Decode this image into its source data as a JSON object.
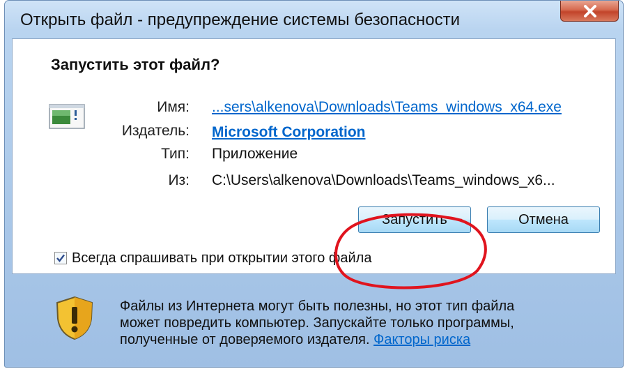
{
  "window": {
    "title": "Открыть файл - предупреждение системы безопасности"
  },
  "dialog": {
    "question": "Запустить этот файл?",
    "fields": {
      "name_label": "Имя:",
      "name_value": "...sers\\alkenova\\Downloads\\Teams_windows_x64.exe",
      "publisher_label": "Издатель:",
      "publisher_value": "Microsoft Corporation",
      "type_label": "Тип:",
      "type_value": "Приложение",
      "from_label": "Из:",
      "from_value": "C:\\Users\\alkenova\\Downloads\\Teams_windows_x6..."
    },
    "buttons": {
      "run": "Запустить",
      "cancel": "Отмена"
    },
    "checkbox": {
      "label": "Всегда спрашивать при открытии этого файла",
      "checked": true
    },
    "warning": {
      "line1": "Файлы из Интернета могут быть полезны, но этот тип файла",
      "line2": "может повредить компьютер. Запускайте только программы,",
      "line3": "полученные от доверяемого издателя.",
      "link": "Факторы риска"
    }
  },
  "colors": {
    "link": "#0066cc",
    "annotation_circle": "#e0141e",
    "close_button": "#c2442a"
  },
  "icons": {
    "close": "close-icon",
    "app": "application-icon",
    "shield": "security-shield-icon",
    "check": "checkmark-icon"
  }
}
